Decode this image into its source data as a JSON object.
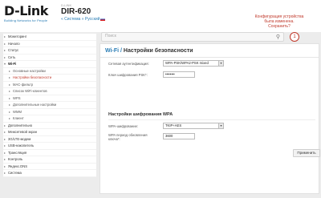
{
  "header": {
    "logo_text": "D-Link",
    "logo_tagline": "Building Networks for People",
    "device_label": "D-LINK",
    "device_model": "DIR-620",
    "links_text": "« Система » Русский",
    "notice": "Конфигурация устройства была изменена. Сохранить?"
  },
  "sidebar": {
    "items": [
      {
        "label": "Мониторинг",
        "kind": "group"
      },
      {
        "label": "Начало",
        "kind": "group"
      },
      {
        "label": "Статус",
        "kind": "group"
      },
      {
        "label": "Сеть",
        "kind": "group"
      },
      {
        "label": "Wi-Fi",
        "kind": "active-group"
      },
      {
        "label": "Основные настройки",
        "kind": "sub"
      },
      {
        "label": "Настройки безопасности",
        "kind": "sub-selected"
      },
      {
        "label": "MAC-фильтр",
        "kind": "sub"
      },
      {
        "label": "Список WiFi-клиентов",
        "kind": "sub"
      },
      {
        "label": "WPS",
        "kind": "sub"
      },
      {
        "label": "Дополнительные настройки",
        "kind": "sub"
      },
      {
        "label": "WMM",
        "kind": "sub"
      },
      {
        "label": "Клиент",
        "kind": "sub"
      },
      {
        "label": "Дополнительно",
        "kind": "group"
      },
      {
        "label": "Межсетевой экран",
        "kind": "group"
      },
      {
        "label": "3G/LTE-модем",
        "kind": "group"
      },
      {
        "label": "USB-накопитель",
        "kind": "group"
      },
      {
        "label": "Трансляция",
        "kind": "group"
      },
      {
        "label": "Контроль",
        "kind": "group"
      },
      {
        "label": "Яндекс.DNS",
        "kind": "group"
      },
      {
        "label": "Система",
        "kind": "group"
      }
    ]
  },
  "search": {
    "placeholder": "Поиск",
    "icon": "search-icon"
  },
  "badge": "1",
  "page": {
    "crumb": "Wi-Fi /",
    "title": "Настройки безопасности"
  },
  "form": {
    "auth_label": "Сетевая аутентификация:",
    "auth_value": "WPA-PSK/WPA2-PSK mixed",
    "psk_label": "Ключ шифрования PSK*:",
    "psk_value": "••••••••",
    "section_title": "Настройки шифрования WPA",
    "cipher_label": "WPA-шифрование:",
    "cipher_value": "TKIP+AES",
    "period_label": "WPA период обновления ключа*:",
    "period_value": "3600"
  },
  "apply_label": "Применить",
  "colors": {
    "accent_red": "#c0392b",
    "link_blue": "#2a7db5"
  }
}
